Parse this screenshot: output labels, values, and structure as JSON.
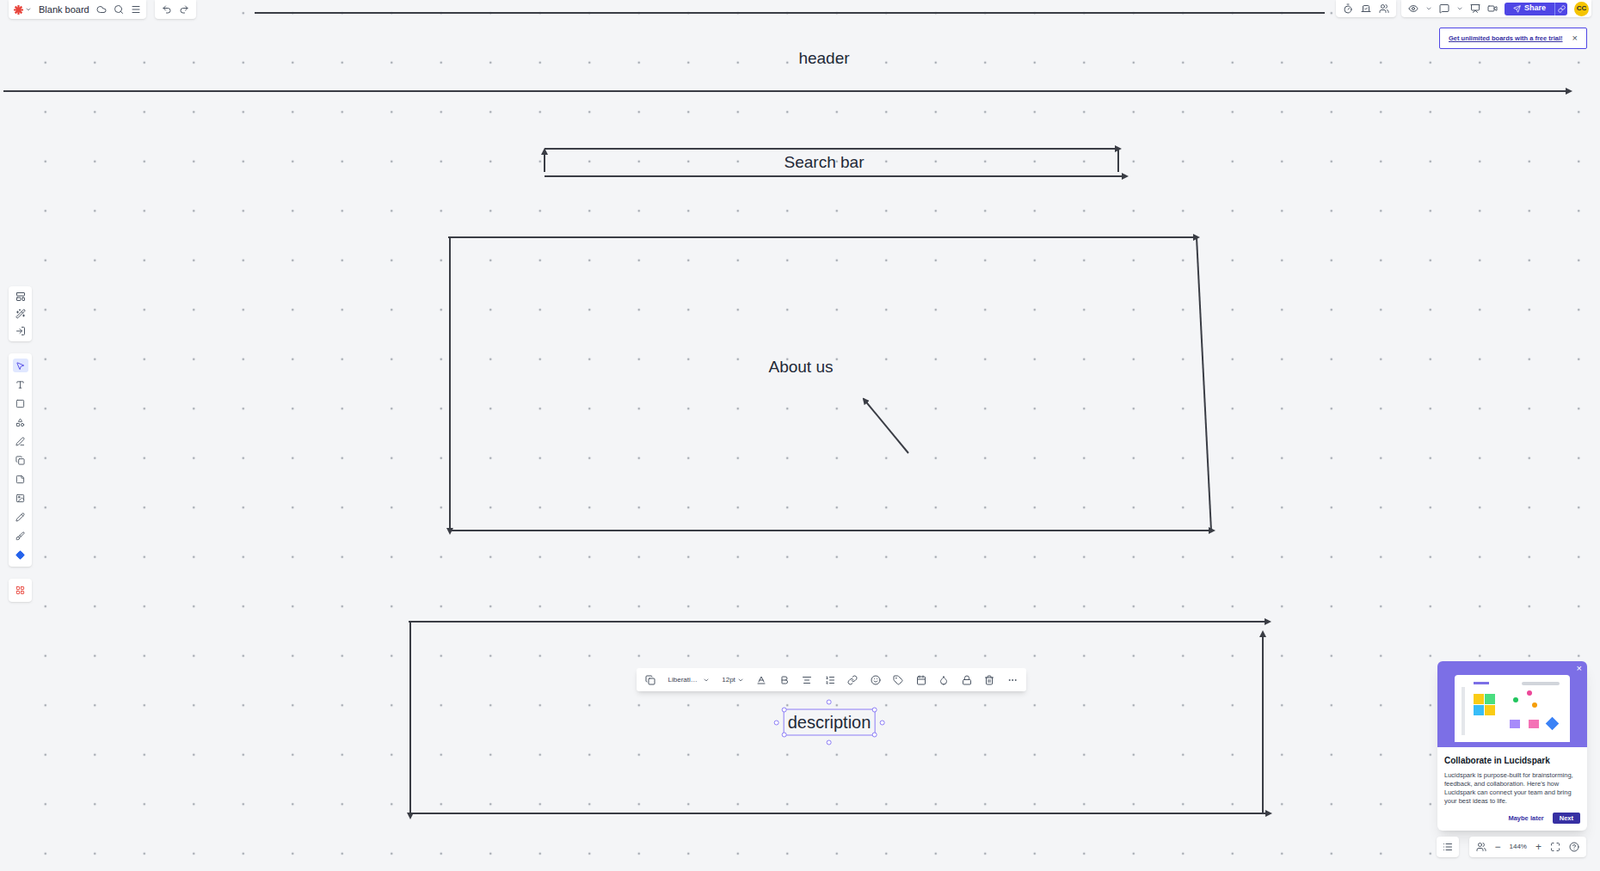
{
  "app": {
    "board_title": "Blank board",
    "share": "Share",
    "avatar": "CC"
  },
  "banner": {
    "text": "Get unlimited boards with a free trial!",
    "close": "×"
  },
  "canvas": {
    "labels": [
      {
        "text": "header",
        "selected": false
      },
      {
        "text": "Search bar",
        "selected": false
      },
      {
        "text": "About us",
        "selected": false
      },
      {
        "text": "description",
        "selected": true
      }
    ]
  },
  "text_toolbar": {
    "font": "Liberati…",
    "size": "12pt"
  },
  "tools": [
    {
      "selected": true
    },
    {
      "selected": false
    },
    {
      "selected": false
    },
    {
      "selected": false
    },
    {
      "selected": false
    },
    {
      "selected": false
    },
    {
      "selected": false
    },
    {
      "selected": false
    },
    {
      "selected": false
    },
    {
      "selected": false
    },
    {
      "selected": false
    }
  ],
  "popup": {
    "title": "Collaborate in Lucidspark",
    "body": "Lucidspark is purpose-built for brainstorming, feedback, and collaboration. Here's how Lucidspark can connect your team and bring your best ideas to life.",
    "buttons": [
      "Maybe later",
      "Next"
    ],
    "close": "×"
  },
  "zoom": {
    "minus": "−",
    "level": "144%",
    "plus": "+"
  }
}
